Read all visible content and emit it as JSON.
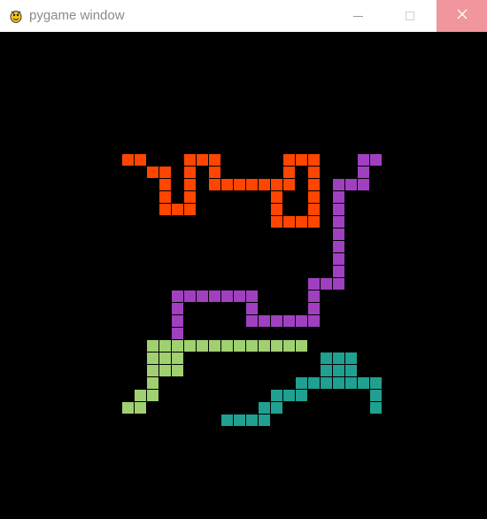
{
  "window": {
    "title": "pygame window",
    "icon": "pygame-snake-icon",
    "controls": {
      "minimize_icon": "minimize-icon",
      "maximize_icon": "maximize-icon",
      "close_icon": "close-icon"
    }
  },
  "game": {
    "background_color": "#000000",
    "grid_cell_size": 14,
    "snakes": [
      {
        "name": "orange-snake",
        "color": "#ff4500",
        "cells": [
          [
            10,
            10
          ],
          [
            11,
            10
          ],
          [
            12,
            11
          ],
          [
            13,
            11
          ],
          [
            13,
            12
          ],
          [
            13,
            13
          ],
          [
            13,
            14
          ],
          [
            14,
            14
          ],
          [
            15,
            14
          ],
          [
            15,
            13
          ],
          [
            15,
            12
          ],
          [
            15,
            11
          ],
          [
            15,
            10
          ],
          [
            16,
            10
          ],
          [
            17,
            10
          ],
          [
            17,
            11
          ],
          [
            17,
            12
          ],
          [
            18,
            12
          ],
          [
            19,
            12
          ],
          [
            20,
            12
          ],
          [
            21,
            12
          ],
          [
            22,
            12
          ],
          [
            23,
            12
          ],
          [
            23,
            11
          ],
          [
            23,
            10
          ],
          [
            24,
            10
          ],
          [
            25,
            10
          ],
          [
            25,
            11
          ],
          [
            25,
            12
          ],
          [
            25,
            13
          ],
          [
            25,
            14
          ],
          [
            25,
            15
          ],
          [
            24,
            15
          ],
          [
            23,
            15
          ],
          [
            22,
            15
          ],
          [
            22,
            14
          ],
          [
            22,
            13
          ]
        ]
      },
      {
        "name": "purple-snake",
        "color": "#a040c0",
        "cells": [
          [
            29,
            10
          ],
          [
            30,
            10
          ],
          [
            29,
            11
          ],
          [
            29,
            12
          ],
          [
            28,
            12
          ],
          [
            27,
            12
          ],
          [
            27,
            13
          ],
          [
            27,
            14
          ],
          [
            27,
            15
          ],
          [
            27,
            16
          ],
          [
            27,
            17
          ],
          [
            27,
            18
          ],
          [
            27,
            19
          ],
          [
            27,
            20
          ],
          [
            26,
            20
          ],
          [
            25,
            20
          ],
          [
            25,
            21
          ],
          [
            25,
            22
          ],
          [
            25,
            23
          ],
          [
            24,
            23
          ],
          [
            23,
            23
          ],
          [
            22,
            23
          ],
          [
            21,
            23
          ],
          [
            20,
            23
          ],
          [
            20,
            22
          ],
          [
            20,
            21
          ],
          [
            19,
            21
          ],
          [
            18,
            21
          ],
          [
            17,
            21
          ],
          [
            16,
            21
          ],
          [
            15,
            21
          ],
          [
            14,
            21
          ],
          [
            14,
            22
          ],
          [
            14,
            23
          ],
          [
            14,
            24
          ]
        ]
      },
      {
        "name": "green-snake",
        "color": "#a0d070",
        "cells": [
          [
            12,
            25
          ],
          [
            13,
            25
          ],
          [
            14,
            25
          ],
          [
            15,
            25
          ],
          [
            16,
            25
          ],
          [
            17,
            25
          ],
          [
            18,
            25
          ],
          [
            19,
            25
          ],
          [
            20,
            25
          ],
          [
            21,
            25
          ],
          [
            22,
            25
          ],
          [
            23,
            25
          ],
          [
            24,
            25
          ],
          [
            12,
            26
          ],
          [
            13,
            26
          ],
          [
            14,
            26
          ],
          [
            12,
            27
          ],
          [
            13,
            27
          ],
          [
            14,
            27
          ],
          [
            12,
            28
          ],
          [
            11,
            29
          ],
          [
            12,
            29
          ],
          [
            10,
            30
          ],
          [
            11,
            30
          ]
        ]
      },
      {
        "name": "teal-snake",
        "color": "#20a090",
        "cells": [
          [
            26,
            26
          ],
          [
            27,
            26
          ],
          [
            28,
            26
          ],
          [
            26,
            27
          ],
          [
            27,
            27
          ],
          [
            28,
            27
          ],
          [
            24,
            28
          ],
          [
            25,
            28
          ],
          [
            26,
            28
          ],
          [
            27,
            28
          ],
          [
            28,
            28
          ],
          [
            29,
            28
          ],
          [
            30,
            28
          ],
          [
            22,
            29
          ],
          [
            23,
            29
          ],
          [
            24,
            29
          ],
          [
            30,
            29
          ],
          [
            21,
            30
          ],
          [
            22,
            30
          ],
          [
            30,
            30
          ],
          [
            18,
            31
          ],
          [
            19,
            31
          ],
          [
            20,
            31
          ],
          [
            21,
            31
          ]
        ]
      }
    ]
  }
}
